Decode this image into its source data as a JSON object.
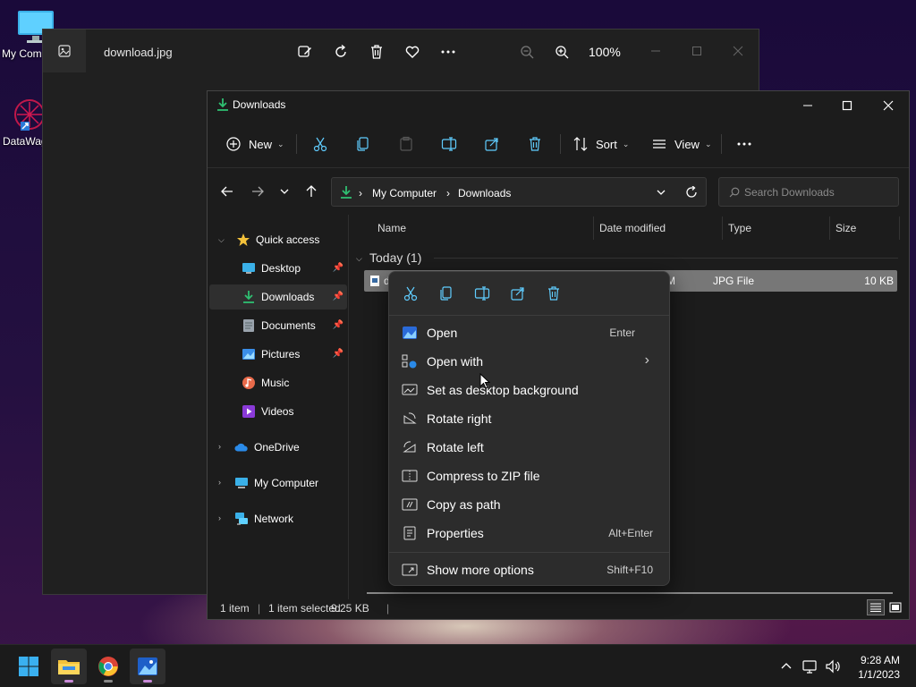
{
  "desktop": {
    "icons": [
      {
        "label": "My Com"
      },
      {
        "label": "DataWag"
      }
    ]
  },
  "photos": {
    "title": "download.jpg",
    "zoom": "100%"
  },
  "explorer": {
    "title": "Downloads",
    "toolbar": {
      "new_label": "New",
      "sort_label": "Sort",
      "view_label": "View"
    },
    "address": {
      "crumbs": [
        "My Computer",
        "Downloads"
      ]
    },
    "search": {
      "placeholder": "Search Downloads"
    },
    "nav": {
      "quick_access": "Quick access",
      "items": [
        {
          "label": "Desktop"
        },
        {
          "label": "Downloads"
        },
        {
          "label": "Documents"
        },
        {
          "label": "Pictures"
        },
        {
          "label": "Music"
        },
        {
          "label": "Videos"
        }
      ],
      "onedrive": "OneDrive",
      "my_computer": "My Computer",
      "network": "Network"
    },
    "columns": [
      "Name",
      "Date modified",
      "Type",
      "Size"
    ],
    "group": "Today (1)",
    "file": {
      "name": "d",
      "date": "AM",
      "type": "JPG File",
      "size": "10 KB"
    },
    "status": {
      "count": "1 item",
      "selected": "1 item selected",
      "size": "9.25 KB"
    }
  },
  "context_menu": {
    "items": [
      {
        "label": "Open",
        "shortcut": "Enter"
      },
      {
        "label": "Open with",
        "shortcut": ""
      },
      {
        "label": "Set as desktop background",
        "shortcut": ""
      },
      {
        "label": "Rotate right",
        "shortcut": ""
      },
      {
        "label": "Rotate left",
        "shortcut": ""
      },
      {
        "label": "Compress to ZIP file",
        "shortcut": ""
      },
      {
        "label": "Copy as path",
        "shortcut": ""
      },
      {
        "label": "Properties",
        "shortcut": "Alt+Enter"
      }
    ],
    "more": {
      "label": "Show more options",
      "shortcut": "Shift+F10"
    }
  },
  "taskbar": {
    "time": "9:28 AM",
    "date": "1/1/2023"
  },
  "colors": {
    "accent": "#60cdff",
    "download_green": "#2fbf71",
    "folder_yellow": "#f3c13a"
  }
}
